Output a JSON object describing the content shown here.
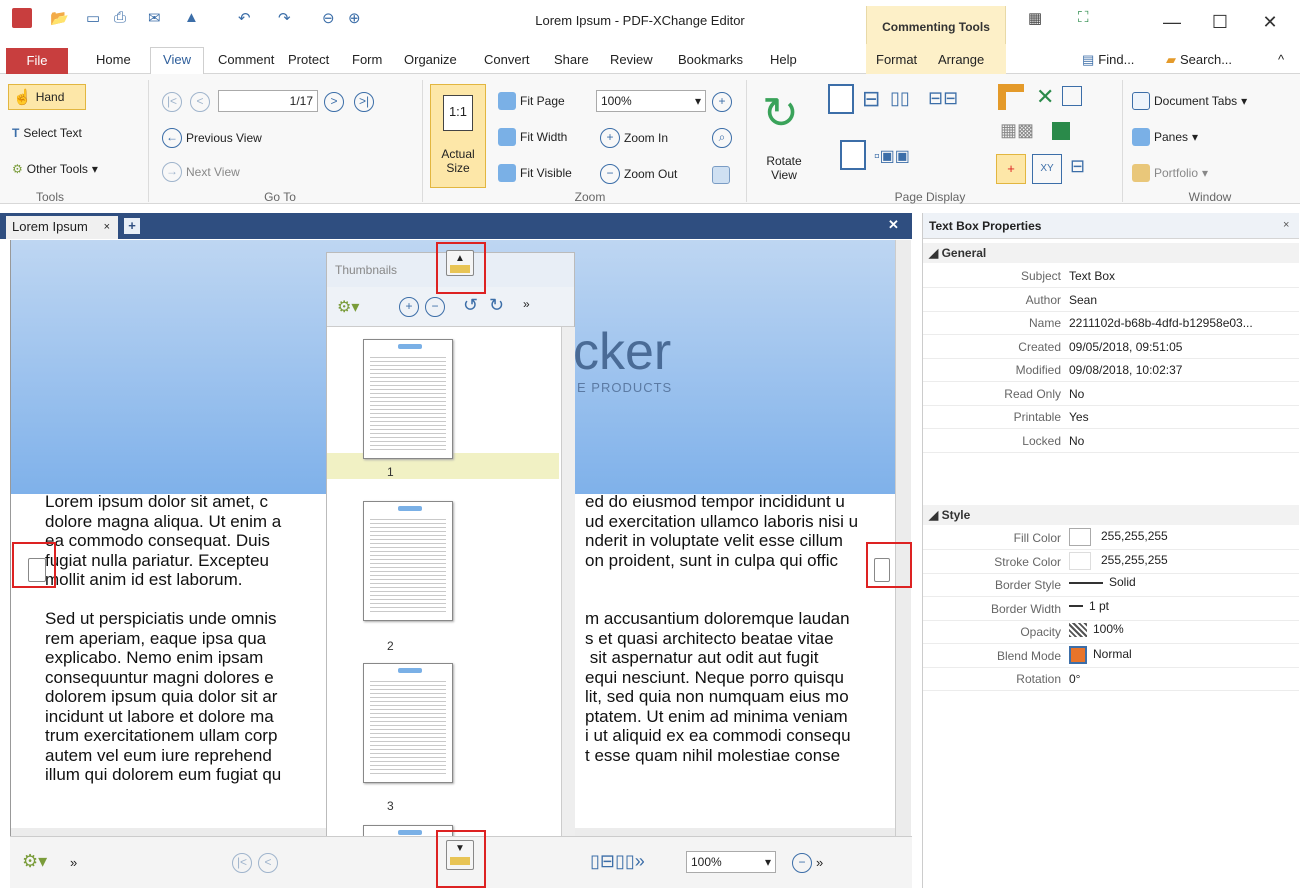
{
  "title_bar": {
    "app_title": "Lorem Ipsum - PDF-XChange Editor",
    "context_group": "Commenting Tools"
  },
  "ribbon_tabs": [
    "File",
    "Home",
    "View",
    "Comment",
    "Protect",
    "Form",
    "Organize",
    "Convert",
    "Share",
    "Review",
    "Bookmarks",
    "Help",
    "Format",
    "Arrange"
  ],
  "tab_right": {
    "find": "Find...",
    "search": "Search..."
  },
  "tools_group": {
    "hand": "Hand",
    "select_text": "Select Text",
    "other_tools": "Other Tools",
    "label": "Tools"
  },
  "goto_group": {
    "page_field": "1/17",
    "previous_view": "Previous View",
    "next_view": "Next View",
    "label": "Go To"
  },
  "zoom_group": {
    "actual_size": "Actual Size",
    "fit_page": "Fit Page",
    "fit_width": "Fit Width",
    "fit_visible": "Fit Visible",
    "zoom_in": "Zoom In",
    "zoom_out": "Zoom Out",
    "zoom_value": "100%",
    "label": "Zoom"
  },
  "rotate_group": {
    "rotate_view": "Rotate View"
  },
  "page_display_group": {
    "label": "Page Display"
  },
  "window_group": {
    "document_tabs": "Document Tabs",
    "panes": "Panes",
    "portfolio": "Portfolio",
    "label": "Window"
  },
  "document": {
    "tab_name": "Lorem Ipsum",
    "logo_text": "cker",
    "logo_sub": "E PRODUCTS",
    "left_column": [
      "Lorem ipsum dolor sit amet, c",
      "dolore magna aliqua. Ut enim a",
      "ea commodo consequat. Duis",
      "fugiat nulla pariatur. Excepteu",
      "mollit anim id est laborum.",
      "",
      "Sed ut perspiciatis unde omnis",
      "rem aperiam, eaque ipsa qua",
      "explicabo. Nemo enim ipsam",
      "consequuntur magni dolores e",
      "dolorem ipsum quia dolor sit ar",
      "incidunt ut labore et dolore ma",
      "trum exercitationem ullam corp",
      "autem vel eum iure reprehend",
      "illum qui dolorem eum fugiat qu"
    ],
    "right_column": [
      "ed do eiusmod tempor incididunt u",
      "ud exercitation ullamco laboris nisi u",
      "nderit in voluptate velit esse cillum",
      "on proident, sunt in culpa qui offic",
      "",
      "",
      "m accusantium doloremque laudan",
      "s et quasi architecto beatae vitae",
      " sit aspernatur aut odit aut fugit",
      "equi nesciunt. Neque porro quisqu",
      "lit, sed quia non numquam eius mo",
      "ptatem. Ut enim ad minima veniam",
      "i ut aliquid ex ea commodi consequ",
      "t esse quam nihil molestiae conse",
      ""
    ]
  },
  "thumbnails": {
    "title": "Thumbnails",
    "pages": [
      "1",
      "2",
      "3"
    ]
  },
  "bottom_bar": {
    "zoom_value": "100%"
  },
  "properties": {
    "title": "Text Box Properties",
    "general_label": "General",
    "general": [
      {
        "label": "Subject",
        "value": "Text Box"
      },
      {
        "label": "Author",
        "value": "Sean"
      },
      {
        "label": "Name",
        "value": "2211102d-b68b-4dfd-b12958e03..."
      },
      {
        "label": "Created",
        "value": "09/05/2018, 09:51:05"
      },
      {
        "label": "Modified",
        "value": "09/08/2018, 10:02:37"
      },
      {
        "label": "Read Only",
        "value": "No"
      },
      {
        "label": "Printable",
        "value": "Yes"
      },
      {
        "label": "Locked",
        "value": "No"
      }
    ],
    "style_label": "Style",
    "style": [
      {
        "label": "Fill Color",
        "value": "255,255,255"
      },
      {
        "label": "Stroke Color",
        "value": "255,255,255"
      },
      {
        "label": "Border Style",
        "value": "Solid"
      },
      {
        "label": "Border Width",
        "value": "1 pt"
      },
      {
        "label": "Opacity",
        "value": "100%"
      },
      {
        "label": "Blend Mode",
        "value": "Normal"
      },
      {
        "label": "Rotation",
        "value": "0°"
      }
    ]
  },
  "colors": {
    "file_tab": "#c83e3e",
    "doc_tab_bar": "#2f4e80",
    "highlight_box": "#dd2222",
    "context_tab": "#fdf0c8"
  }
}
